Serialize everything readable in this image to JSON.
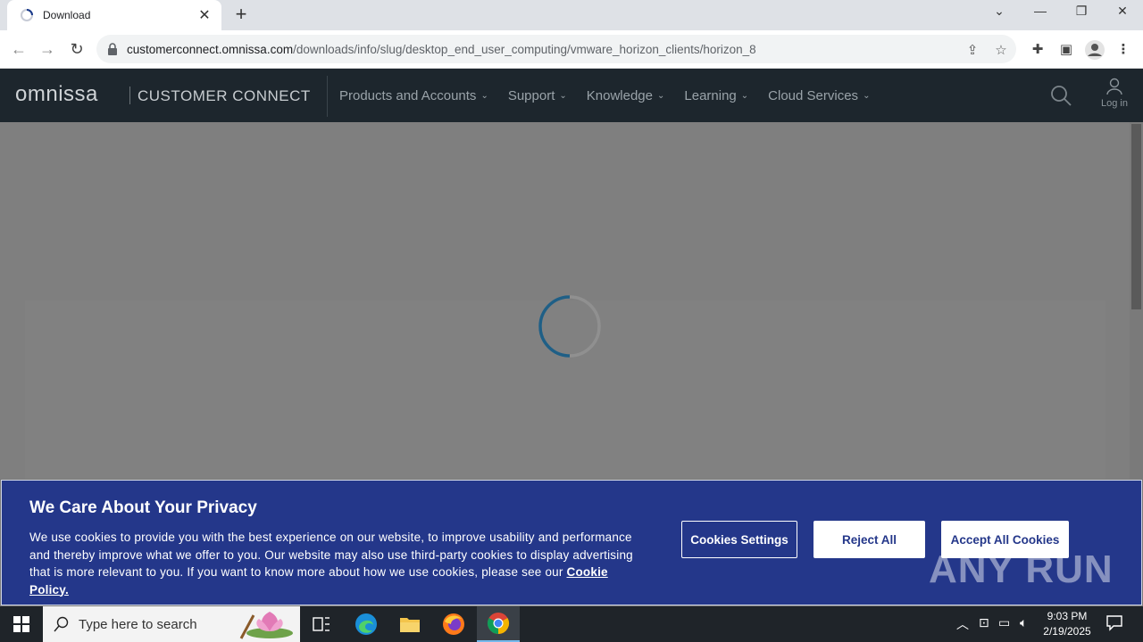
{
  "browser": {
    "tab_title": "Download",
    "url_host": "customerconnect.omnissa.com",
    "url_path": "/downloads/info/slug/desktop_end_user_computing/vmware_horizon_clients/horizon_8"
  },
  "site": {
    "logo": "omnissa",
    "brand": "CUSTOMER CONNECT",
    "nav": [
      {
        "label": "Products and Accounts"
      },
      {
        "label": "Support"
      },
      {
        "label": "Knowledge"
      },
      {
        "label": "Learning"
      },
      {
        "label": "Cloud Services"
      }
    ],
    "login_label": "Log in"
  },
  "cookie_banner": {
    "title": "We Care About Your Privacy",
    "text": "We use cookies to provide you with the best experience on our website, to improve usability and performance and thereby improve what we offer to you. Our website may also use third-party cookies to display advertising that is more relevant to you. If you want to know more about how we use cookies, please see our",
    "link_label": "Cookie Policy.",
    "settings_label": "Cookies Settings",
    "reject_label": "Reject All",
    "accept_label": "Accept All Cookies",
    "watermark": "ANY RUN"
  },
  "taskbar": {
    "search_placeholder": "Type here to search",
    "time": "9:03 PM",
    "date": "2/19/2025"
  },
  "colors": {
    "site_header": "#1d262d",
    "cookie_bg": "#24378a",
    "spinner": "#1f5f86"
  }
}
